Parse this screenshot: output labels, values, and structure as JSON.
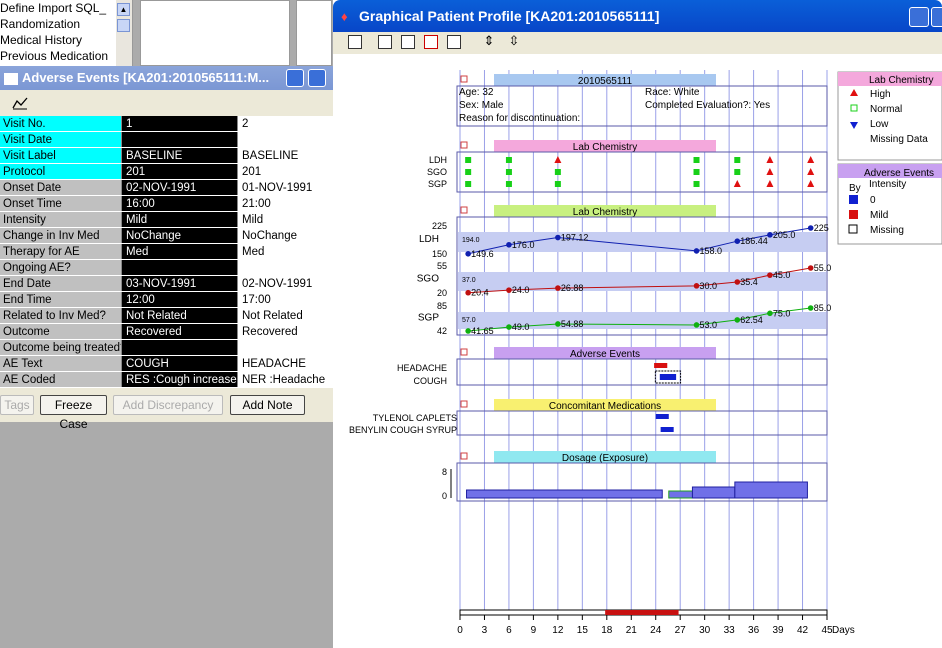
{
  "nav": {
    "items": [
      "Define Import SQL_",
      "Randomization",
      "Medical History",
      "Previous Medication"
    ]
  },
  "ae_window": {
    "title": "Adverse Events [KA201:2010565111:M...",
    "rows": [
      {
        "label": "Visit No.",
        "v1": "1",
        "v2": "2",
        "style": "cy"
      },
      {
        "label": "Visit Date",
        "v1": "",
        "v2": "",
        "style": "cy"
      },
      {
        "label": "Visit Label",
        "v1": "BASELINE",
        "v2": "BASELINE",
        "style": "cy"
      },
      {
        "label": "Protocol",
        "v1": "201",
        "v2": "201",
        "style": "cy"
      },
      {
        "label": "Onset Date",
        "v1": "02-NOV-1991",
        "v2": "01-NOV-1991",
        "style": "gr"
      },
      {
        "label": "Onset Time",
        "v1": "16:00",
        "v2": "21:00",
        "style": "gr"
      },
      {
        "label": "Intensity",
        "v1": "Mild",
        "v2": "Mild",
        "style": "gr"
      },
      {
        "label": "Change in Inv Med",
        "v1": "NoChange",
        "v2": "NoChange",
        "style": "gr"
      },
      {
        "label": "Therapy for AE",
        "v1": "Med",
        "v2": "Med",
        "style": "gr"
      },
      {
        "label": "Ongoing AE?",
        "v1": "",
        "v2": "",
        "style": "gr"
      },
      {
        "label": "End Date",
        "v1": "03-NOV-1991",
        "v2": "02-NOV-1991",
        "style": "gr"
      },
      {
        "label": "End Time",
        "v1": "12:00",
        "v2": "17:00",
        "style": "gr"
      },
      {
        "label": "Related to Inv Med?",
        "v1": "Not Related",
        "v2": "Not Related",
        "style": "gr"
      },
      {
        "label": "Outcome",
        "v1": "Recovered",
        "v2": "Recovered",
        "style": "gr"
      },
      {
        "label": "Outcome being treated?",
        "v1": "",
        "v2": "",
        "style": "gr"
      },
      {
        "label": "AE Text",
        "v1": "COUGH",
        "v2": "HEADACHE",
        "style": "gr"
      },
      {
        "label": "AE Coded",
        "v1": "RES :Cough increased",
        "v2": "NER :Headache",
        "style": "gr"
      }
    ],
    "buttons": {
      "tags": "Tags",
      "freeze": "Freeze Case",
      "add_disc": "Add Discrepancy",
      "add_note": "Add Note"
    }
  },
  "profile": {
    "title": "Graphical Patient Profile [KA201:2010565111]",
    "patient": {
      "id": "2010565111",
      "age": "Age: 32",
      "race": "Race: White",
      "sex": "Sex: Male",
      "completed": "Completed Evaluation?: Yes",
      "reason": "Reason for discontinuation:"
    },
    "sections": {
      "lab1": "Lab Chemistry",
      "lab2": "Lab Chemistry",
      "ae": "Adverse Events",
      "cm": "Concomitant Medications",
      "dose": "Dosage (Exposure)"
    },
    "lab_rows": [
      "LDH",
      "SGO",
      "SGP"
    ],
    "ae_rows": [
      "HEADACHE",
      "COUGH"
    ],
    "cm_rows": [
      "TYLENOL CAPLETS",
      "BENYLIN COUGH SYRUP"
    ],
    "ldh": {
      "label": "LDH",
      "hi": "225",
      "lo": "150",
      "start": "194.0",
      "points": [
        {
          "d": 1,
          "v": "149.6"
        },
        {
          "d": 6,
          "v": "176.0"
        },
        {
          "d": 12,
          "v": "197.12"
        },
        {
          "d": 29,
          "v": "158.0"
        },
        {
          "d": 34,
          "v": "186.44"
        },
        {
          "d": 38,
          "v": "205.0"
        },
        {
          "d": 43,
          "v": "225"
        }
      ],
      "values": [
        149.6,
        176.0,
        197.12,
        158.0,
        186.44,
        205.0,
        225
      ]
    },
    "sgo": {
      "label": "SGO",
      "hi": "55",
      "lo": "20",
      "start": "37.0",
      "points": [
        {
          "d": 1,
          "v": "20.4"
        },
        {
          "d": 6,
          "v": "24.0"
        },
        {
          "d": 12,
          "v": "26.88"
        },
        {
          "d": 29,
          "v": "30.0"
        },
        {
          "d": 34,
          "v": "35.4"
        },
        {
          "d": 38,
          "v": "45.0"
        },
        {
          "d": 43,
          "v": "55.0"
        }
      ],
      "values": [
        20.4,
        24.0,
        26.88,
        30.0,
        35.4,
        45.0,
        55.0
      ]
    },
    "sgp": {
      "label": "SGP",
      "hi": "85",
      "lo": "42",
      "start": "57.0",
      "points": [
        {
          "d": 1,
          "v": "41.65"
        },
        {
          "d": 6,
          "v": "49.0"
        },
        {
          "d": 12,
          "v": "54.88"
        },
        {
          "d": 29,
          "v": "53.0"
        },
        {
          "d": 34,
          "v": "62.54"
        },
        {
          "d": 38,
          "v": "75.0"
        },
        {
          "d": 43,
          "v": "85.0"
        }
      ],
      "values": [
        41.65,
        49.0,
        54.88,
        53.0,
        62.54,
        75.0,
        85.0
      ]
    },
    "dose_axis": [
      "8",
      "0"
    ],
    "x_ticks": [
      "0",
      "3",
      "6",
      "9",
      "12",
      "15",
      "18",
      "21",
      "24",
      "27",
      "30",
      "33",
      "36",
      "39",
      "42",
      "45"
    ],
    "x_unit": "Days",
    "legend1": {
      "title": "Lab Chemistry",
      "items": [
        "High",
        "Normal",
        "Low",
        "Missing Data"
      ]
    },
    "legend2": {
      "title": "Adverse Events",
      "by": "By",
      "by2": "Intensity",
      "items": [
        "0",
        "Mild",
        "Missing"
      ]
    },
    "colors": {
      "ldh": "#1020b0",
      "sgo": "#c01010",
      "sgp": "#10b010",
      "band": "#c6cdf2"
    }
  }
}
